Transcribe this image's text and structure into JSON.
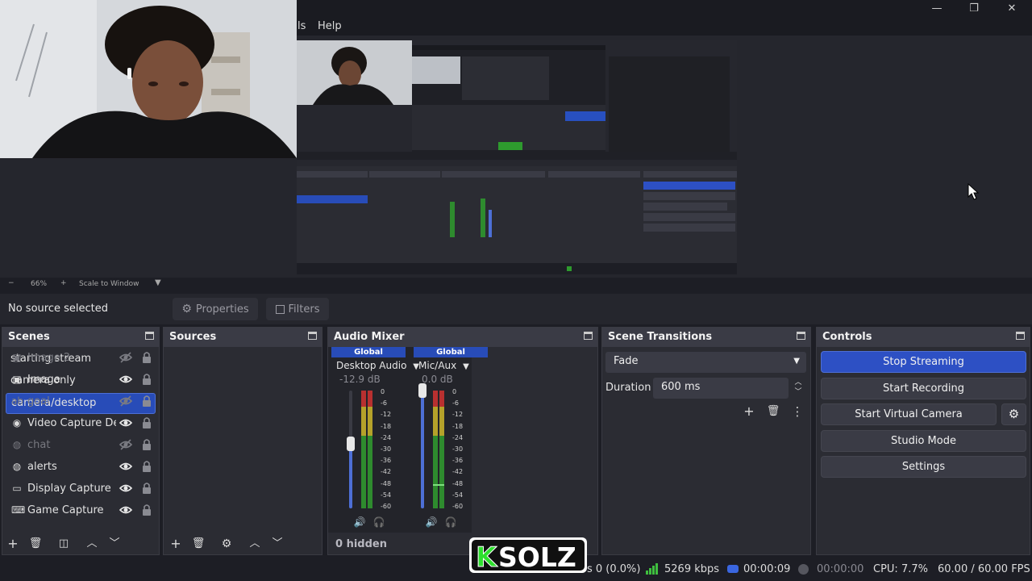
{
  "window": {
    "minimize_glyph": "—",
    "maximize_glyph": "❐",
    "close_glyph": "✕"
  },
  "menu": {
    "items": [
      "ls",
      "Help"
    ]
  },
  "preview": {
    "zoom_minus": "−",
    "zoom_level": "66%",
    "zoom_plus": "+",
    "scale_mode": "Scale to Window"
  },
  "context": {
    "no_source": "No source selected",
    "properties_label": "Properties",
    "filters_label": "Filters"
  },
  "scenes": {
    "title": "Scenes",
    "items": [
      "starting stream",
      "camera only",
      "camera/desktop"
    ],
    "selected_index": 2
  },
  "sources": {
    "title": "Sources",
    "items": [
      {
        "label": "Image 2",
        "icon": "image-icon",
        "visible": false
      },
      {
        "label": "Image",
        "icon": "image-icon",
        "visible": true
      },
      {
        "label": "goal",
        "icon": "text-icon",
        "visible": false
      },
      {
        "label": "Video Capture De",
        "icon": "camera-icon",
        "visible": true
      },
      {
        "label": "chat",
        "icon": "browser-icon",
        "visible": false
      },
      {
        "label": "alerts",
        "icon": "browser-icon",
        "visible": true
      },
      {
        "label": "Display Capture",
        "icon": "monitor-icon",
        "visible": true
      },
      {
        "label": "Game Capture",
        "icon": "gamepad-icon",
        "visible": true
      }
    ]
  },
  "mixer": {
    "title": "Audio Mixer",
    "hidden_label": "0 hidden",
    "channels": [
      {
        "badge": "Global",
        "name": "Desktop Audio",
        "db": "-12.9 dB",
        "volume_fraction": 0.6
      },
      {
        "badge": "Global",
        "name": "Mic/Aux",
        "db": "0.0 dB",
        "volume_fraction": 1.0
      }
    ],
    "ticks": [
      "0",
      "-6",
      "-12",
      "-18",
      "-24",
      "-30",
      "-36",
      "-42",
      "-48",
      "-54",
      "-60"
    ]
  },
  "transitions": {
    "title": "Scene Transitions",
    "selected": "Fade",
    "duration_label": "Duration",
    "duration_value": "600 ms"
  },
  "controls": {
    "title": "Controls",
    "stop_streaming": "Stop Streaming",
    "start_recording": "Start Recording",
    "start_virtual_camera": "Start Virtual Camera",
    "studio_mode": "Studio Mode",
    "settings": "Settings"
  },
  "status": {
    "dropped": "s 0 (0.0%)",
    "bitrate": "5269 kbps",
    "stream_time": "00:00:09",
    "record_time": "00:00:00",
    "cpu": "CPU: 7.7%",
    "fps": "60.00 / 60.00 FPS"
  },
  "watermark": {
    "text": "KSOLZ"
  },
  "colors": {
    "accent": "#284cb8",
    "dock_header": "#3a3b45",
    "dock_bg": "#2b2c33",
    "meter_green": "#2e8b2e",
    "meter_yellow": "#b5a22a",
    "meter_red": "#b83030"
  }
}
